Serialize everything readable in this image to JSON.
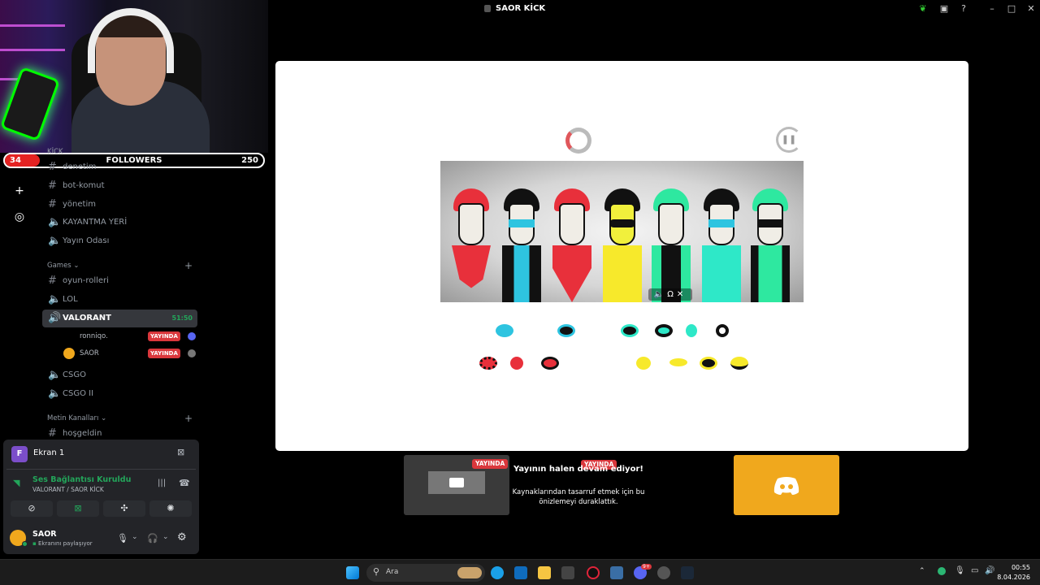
{
  "window": {
    "title": "SAOR KİCK"
  },
  "followers": {
    "current": "34",
    "label": "FOLLOWERS",
    "goal": "250",
    "progress_fraction": 0.136
  },
  "channels": {
    "top_category": "KİCK",
    "items_top": [
      "denetim",
      "bot-komut",
      "yönetim",
      "KAYANTMA YERİ",
      "Yayın Odası"
    ],
    "games_category": "Games",
    "games_items": [
      "oyun-rolleri",
      "LOL"
    ],
    "active_channel": {
      "label": "VALORANT",
      "timer": "51:50"
    },
    "voice_users": [
      {
        "name": "ronniqo.",
        "badge": "YAYINDA"
      },
      {
        "name": "SAOR",
        "badge": "YAYINDA"
      }
    ],
    "games_items_after": [
      "CSGO",
      "CSGO II"
    ],
    "text_category": "Metin Kanalları",
    "text_items": [
      "hoşgeldin"
    ]
  },
  "panel": {
    "screen_share": {
      "avatar_letter": "F",
      "label": "Ekran 1"
    },
    "connection": {
      "status": "Ses Bağlantısı Kuruldu",
      "detail": "VALORANT / SAOR KİCK"
    },
    "user": {
      "name": "SAOR",
      "status": "Ekranını paylaşıyor"
    }
  },
  "preview": {
    "badge": "YAYINDA",
    "badge2": "YAYINDA",
    "title": "Yayının halen devam ediyor!",
    "note": "Kaynaklarından tasarruf etmek için bu önizlemeyi duraklattık."
  },
  "taskbar": {
    "search_placeholder": "Ara",
    "time": "00:55",
    "date": "8.04.2026",
    "discord_badge": "9+"
  },
  "colors": {
    "accent_green": "#23a55a",
    "live_red": "#da373c",
    "discord_box": "#f0a81d",
    "stage_bg": "#ffffff"
  }
}
